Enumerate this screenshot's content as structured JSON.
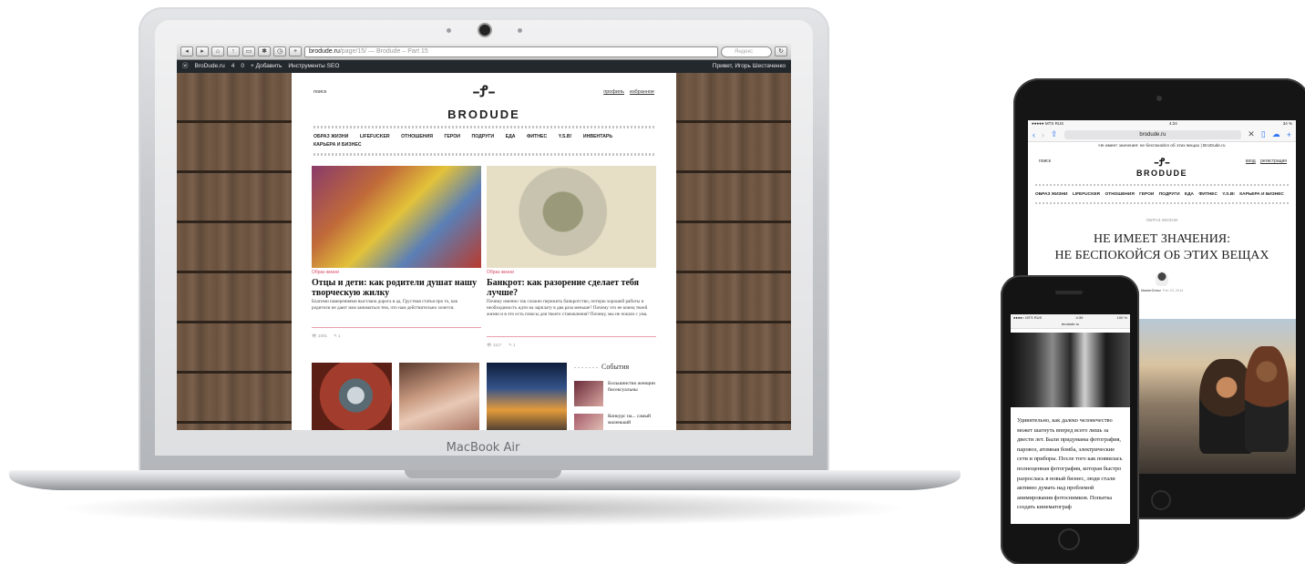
{
  "laptop": {
    "label": "MacBook Air",
    "browser": {
      "url_host": "brodude.ru",
      "url_rest": "/page/15/ — Brodude – Part 15",
      "search_placeholder": "Яндекс"
    },
    "adminbar": {
      "items": [
        "BroDude.ru",
        "4",
        "0",
        "+ Добавить",
        "Инструменты SEO"
      ],
      "greeting": "Привет, Игорь Шестаченко"
    },
    "site": {
      "search": "поиск",
      "user_links": [
        "профиль",
        "избранное"
      ],
      "logo_text": "BRODUDE",
      "nav": [
        "ОБРАЗ ЖИЗНИ",
        "LIFEFUCKER",
        "ОТНОШЕНИЯ",
        "ГЕРОИ",
        "ПОДРУГИ",
        "ЕДА",
        "ФИТНЕС",
        "Y.S.B!",
        "ИНВЕНТАРЬ",
        "КАРЬЕРА И БИЗНЕС"
      ],
      "articles": [
        {
          "category": "Образ жизни",
          "title": "Отцы и дети: как родители душат нашу творческую жилку",
          "text": "Благими намерениями выстлана дорога в ад. Грустная статья про то, как родители не дают нам заниматься тем, что нам действительно хочется.",
          "views": "1001",
          "comments": "1"
        },
        {
          "category": "Образ жизни",
          "title": "Банкрот: как разорение сделает тебя лучше?",
          "text": "Почему именно так сложно пережить банкротство, потерю хорошей работы и необходимость идти на зарплату в два раза меньше? Почему это не конец твоей жизни и в это есть плюсы для твоего становления? Почему, мы не пошли с ума.",
          "views": "1117",
          "comments": "1"
        }
      ],
      "events": {
        "heading": "События",
        "items": [
          "Большинство женщин бисексуальны",
          "Конкурс на... самый маленький"
        ]
      }
    }
  },
  "tablet": {
    "status": {
      "carrier": "●●●●● MTS RUS",
      "time": "4:24",
      "battery": "34 %"
    },
    "url": "brodude.ru",
    "tab_title": "Не имеет значения: не беспокойся об этих вещах | BroDude.ru",
    "search": "поиск",
    "user_links": [
      "вход",
      "регистрация"
    ],
    "logo_text": "BRODUDE",
    "nav": [
      "ОБРАЗ ЖИЗНИ",
      "LIFEFUCKER",
      "ОТНОШЕНИЯ",
      "ГЕРОИ",
      "ПОДРУГИ",
      "ЕДА",
      "ФИТНЕС",
      "Y.S.B!",
      "КАРЬЕРА И БИЗНЕС"
    ],
    "category": "ОБРАЗ ЖИЗНИ",
    "title_line1": "Не имеет значения:",
    "title_line2": "не беспокойся об этих вещах",
    "author": "MasterGreez",
    "date": "Feb 23, 2014"
  },
  "phone": {
    "status": {
      "carrier": "●●●●○ MTS RUS",
      "time": "4:39",
      "battery": "100 %"
    },
    "url": "brodude.ru",
    "text": "Удивительно, как далеко человечество может шагнуть вперед всего лишь за двести лет. Были придуманы фотография, паровоз, атомная бомба, электрические сети и приборы. После того как появилась полноценная фотография, которая быстро разрослась в новый бизнес, люди стали активно думать над проблемой анимирования фотоснимков. Попытка создать кинематограф"
  }
}
